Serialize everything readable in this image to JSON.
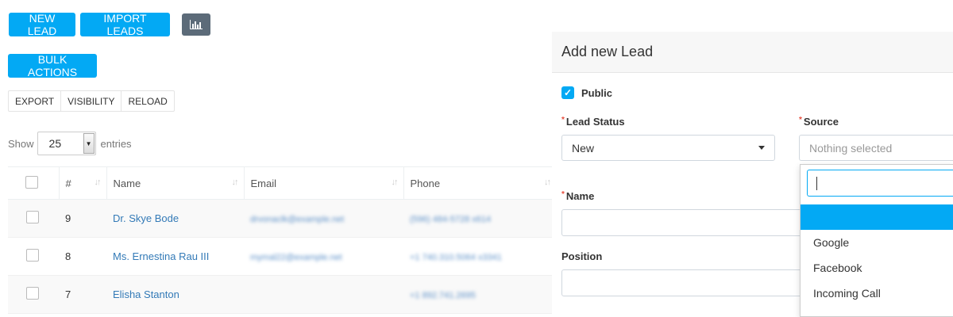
{
  "toolbar": {
    "new_lead": "NEW LEAD",
    "import_leads": "IMPORT LEADS",
    "chart_icon": "bar-chart-icon",
    "bulk_actions": "BULK ACTIONS"
  },
  "export_group": {
    "export": "EXPORT",
    "visibility": "VISIBILITY",
    "reload": "RELOAD"
  },
  "length_menu": {
    "show": "Show",
    "value": "25",
    "entries": "entries"
  },
  "table": {
    "headers": {
      "number": "#",
      "name": "Name",
      "email": "Email",
      "phone": "Phone"
    },
    "rows": [
      {
        "id": "9",
        "name": "Dr. Skye Bode",
        "email": "drvonaclk@example.net",
        "phone": "(596) 484-5728 x614"
      },
      {
        "id": "8",
        "name": "Ms. Ernestina Rau III",
        "email": "mymal22@example.net",
        "phone": "+1 740.310.5064 x3341"
      },
      {
        "id": "7",
        "name": "Elisha Stanton",
        "email": "",
        "phone": "+1 892.741.2695"
      }
    ]
  },
  "panel": {
    "title": "Add new Lead",
    "public_label": "Public",
    "lead_status_label": "Lead Status",
    "lead_status_value": "New",
    "source_label": "Source",
    "source_placeholder": "Nothing selected",
    "name_label": "Name",
    "position_label": "Position"
  },
  "source_dropdown": {
    "search_value": "",
    "options": [
      "",
      "Google",
      "Facebook",
      "Incoming Call"
    ]
  },
  "colors": {
    "accent": "#03a9f4",
    "link": "#337ab7",
    "chart_button": "#5c6b79",
    "required": "#e74c3c"
  }
}
